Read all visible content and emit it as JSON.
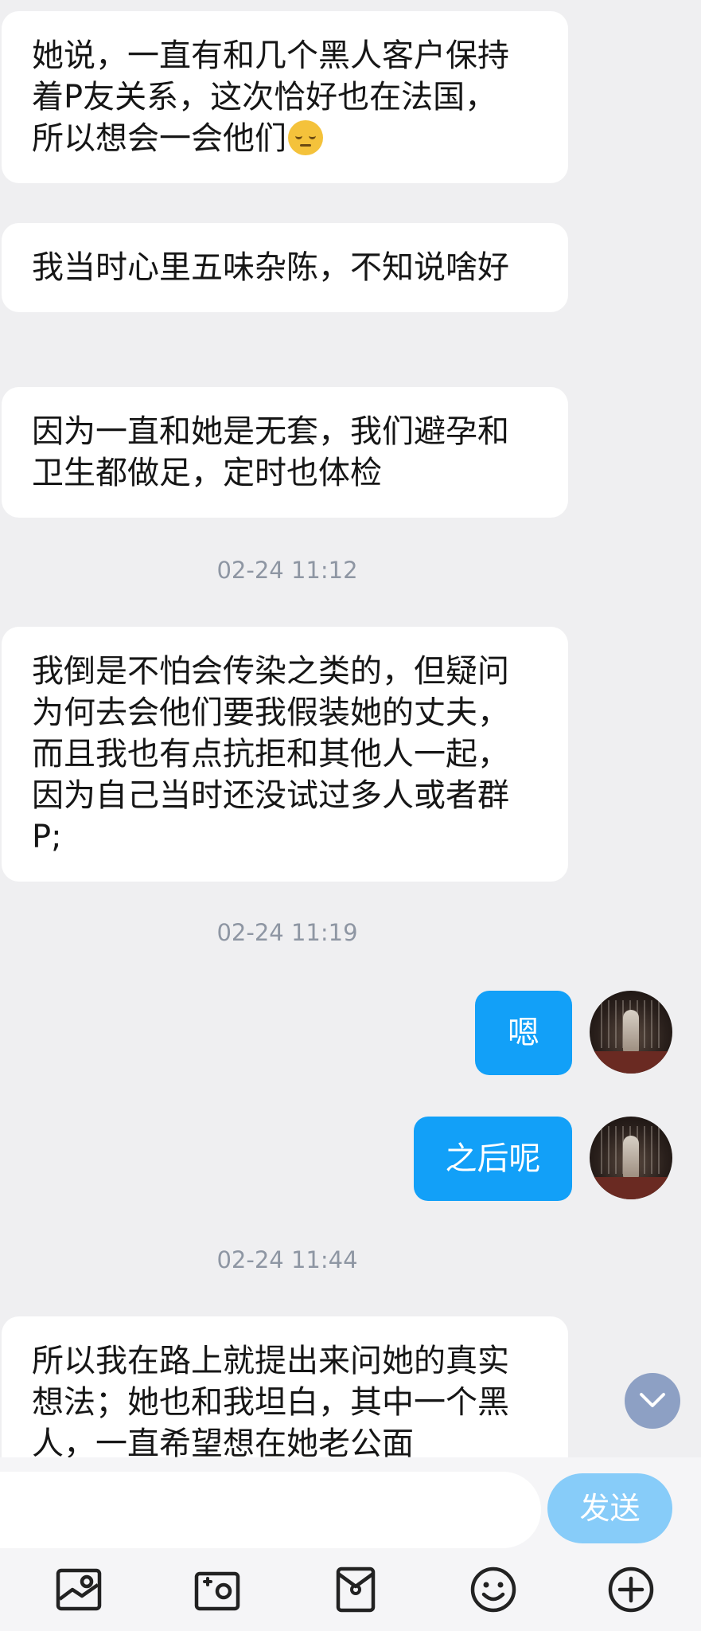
{
  "messages": {
    "m1": {
      "text": "她说，一直有和几个黑人客户保持着P友关系，这次恰好也在法国，所以想会一会他们",
      "emoji": "pensive-face"
    },
    "m2": {
      "text": "我当时心里五味杂陈，不知说啥好"
    },
    "m3": {
      "text": "因为一直和她是无套，我们避孕和卫生都做足，定时也体检"
    },
    "t1": "02-24 11:12",
    "m4": {
      "text": "我倒是不怕会传染之类的，但疑问为何去会他们要我假装她的丈夫，而且我也有点抗拒和其他人一起，因为自己当时还没试过多人或者群P;"
    },
    "t2": "02-24 11:19",
    "out1": {
      "text": "嗯"
    },
    "out2": {
      "text": "之后呢"
    },
    "t3": "02-24 11:44",
    "m5": {
      "text": "所以我在路上就提出来问她的真实想法；她也和我坦白，其中一个黑人，一直希望想在她老公面"
    }
  },
  "input": {
    "placeholder": "",
    "value": ""
  },
  "send_label": "发送",
  "toolbar_icons": [
    "image-icon",
    "camera-icon",
    "red-packet-icon",
    "emoji-icon",
    "plus-icon"
  ],
  "colors": {
    "background": "#efeff1",
    "incoming_bubble": "#ffffff",
    "outgoing_bubble": "#12a0f8",
    "send_button": "#87ccf9",
    "timestamp": "#8e96a3",
    "scroll_button": "#8da0c4"
  }
}
